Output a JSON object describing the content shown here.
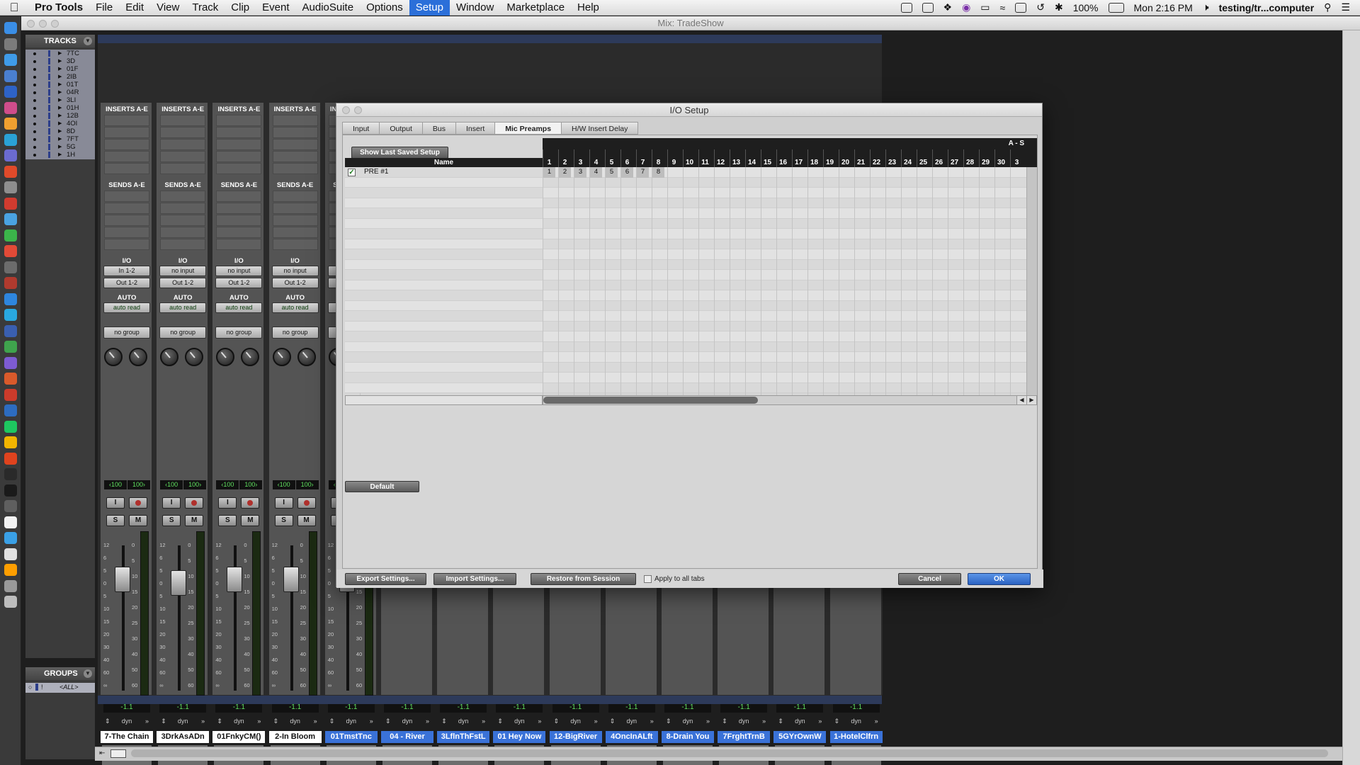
{
  "menubar": {
    "app": "Pro Tools",
    "items": [
      "File",
      "Edit",
      "View",
      "Track",
      "Clip",
      "Event",
      "AudioSuite",
      "Options",
      "Setup",
      "Window",
      "Marketplace",
      "Help"
    ],
    "active": "Setup",
    "battery": "100%",
    "clock": "Mon 2:16 PM",
    "user": "testing/tr...computer"
  },
  "window": {
    "title": "Mix: TradeShow"
  },
  "tracks_panel": {
    "title": "TRACKS",
    "tracks": [
      "7TC",
      "3D",
      "01F",
      "2IB",
      "01T",
      "04R",
      "3LI",
      "01H",
      "12B",
      "4OI",
      "8D",
      "7FT",
      "5G",
      "1H"
    ]
  },
  "groups_panel": {
    "title": "GROUPS",
    "row_label": "<ALL>"
  },
  "mixer": {
    "inserts_label": "INSERTS A-E",
    "sends_label": "SENDS A-E",
    "io_label": "I/O",
    "auto_label": "AUTO",
    "auto_value": "auto read",
    "group_value": "no group",
    "pan_left": "‹100",
    "pan_right": "100›",
    "vol": "-1.1",
    "dyn": "dyn",
    "solo": "S",
    "mute": "M",
    "input": "I",
    "scale": [
      "12",
      "6",
      "5",
      "0",
      "5",
      "10",
      "15",
      "20",
      "30",
      "40",
      "60",
      "∞"
    ],
    "meter_scale": [
      "0",
      "5",
      "10",
      "15",
      "20",
      "25",
      "30",
      "40",
      "50",
      "60"
    ],
    "strips": [
      {
        "name": "7-The Chain",
        "input": "In 1-2",
        "output": "Out 1-2",
        "blue": false
      },
      {
        "name": "3DrkAsADn",
        "input": "no input",
        "output": "Out 1-2",
        "blue": false
      },
      {
        "name": "01FnkyCM()",
        "input": "no input",
        "output": "Out 1-2",
        "blue": false
      },
      {
        "name": "2-In Bloom",
        "input": "no input",
        "output": "Out 1-2",
        "blue": false
      },
      {
        "name": "01TmstTnc",
        "input": "no input",
        "output": "Out 1-2",
        "blue": true
      },
      {
        "name": "04 - River",
        "blue": true
      },
      {
        "name": "3LflnThFstL",
        "blue": true
      },
      {
        "name": "01 Hey Now",
        "blue": true
      },
      {
        "name": "12-BigRiver",
        "blue": true
      },
      {
        "name": "4OncInALft",
        "blue": true
      },
      {
        "name": "8-Drain You",
        "blue": true
      },
      {
        "name": "7FrghtTrnB",
        "blue": true
      },
      {
        "name": "5GYrOwnW",
        "blue": true
      },
      {
        "name": "1-HotelClfrn",
        "blue": true
      }
    ]
  },
  "dialog": {
    "title": "I/O Setup",
    "tabs": [
      "Input",
      "Output",
      "Bus",
      "Insert",
      "Mic Preamps",
      "H/W Insert Delay"
    ],
    "active_tab": "Mic Preamps",
    "show_last_button": "Show Last Saved Setup",
    "name_header": "Name",
    "group_header": "A - S",
    "columns": [
      "1",
      "2",
      "3",
      "4",
      "5",
      "6",
      "7",
      "8",
      "9",
      "10",
      "11",
      "12",
      "13",
      "14",
      "15",
      "16",
      "17",
      "18",
      "19",
      "20",
      "21",
      "22",
      "23",
      "24",
      "25",
      "26",
      "27",
      "28",
      "29",
      "30",
      "3"
    ],
    "rows": [
      {
        "name": "PRE #1",
        "checked": true,
        "assigned": [
          "1",
          "2",
          "3",
          "4",
          "5",
          "6",
          "7",
          "8"
        ]
      }
    ],
    "default_button": "Default",
    "footer": {
      "export": "Export Settings...",
      "import": "Import Settings...",
      "restore": "Restore from Session",
      "apply_all": "Apply to all tabs",
      "cancel": "Cancel",
      "ok": "OK"
    }
  }
}
